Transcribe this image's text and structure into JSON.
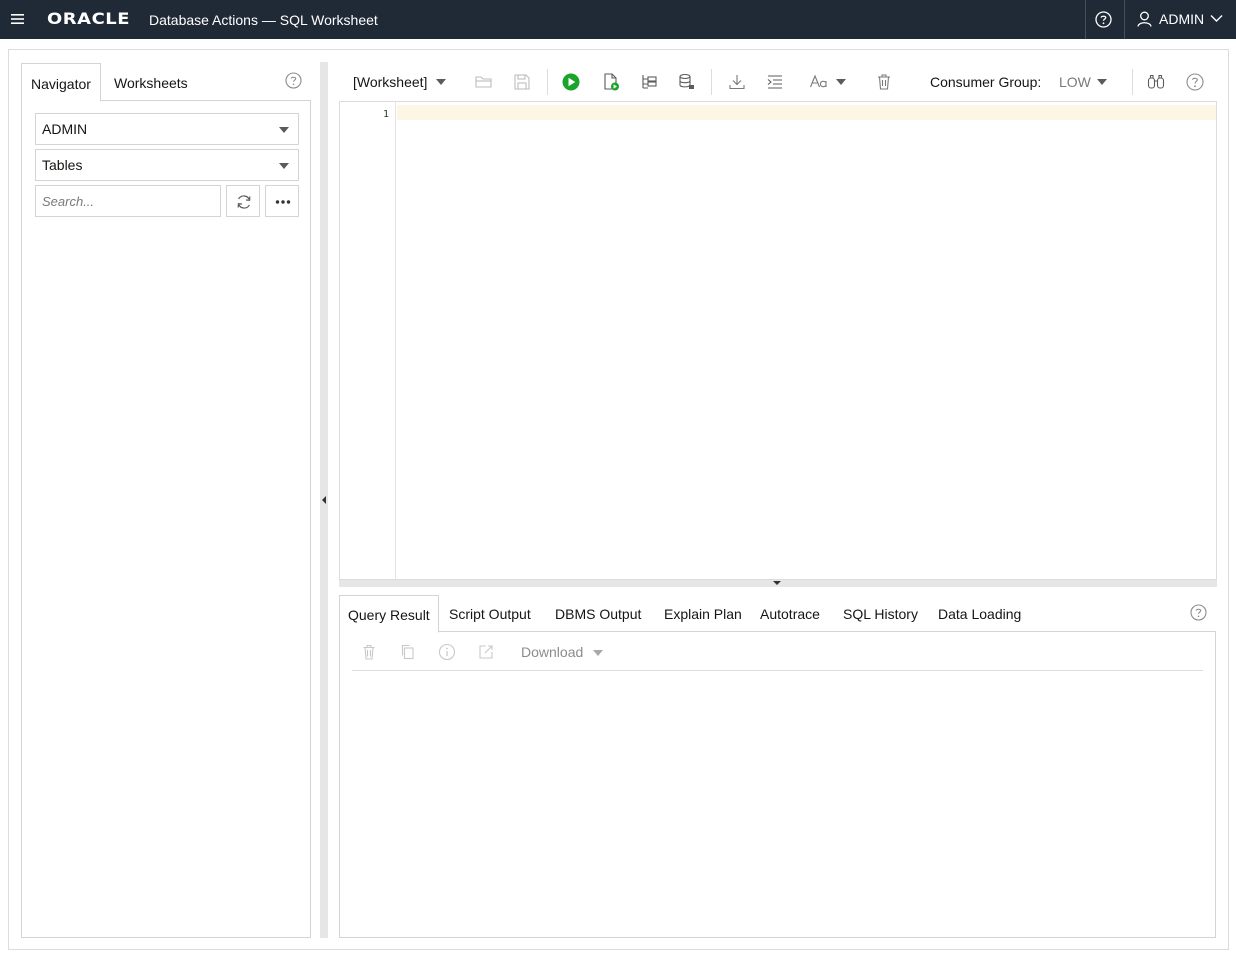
{
  "header": {
    "logo_text": "ORACLE",
    "app_title": "Database Actions — SQL Worksheet",
    "user_name": "ADMIN",
    "background": "#1f2a36"
  },
  "navigator": {
    "tabs": [
      {
        "label": "Navigator",
        "active": true
      },
      {
        "label": "Worksheets",
        "active": false
      }
    ],
    "schema_select": "ADMIN",
    "object_type_select": "Tables",
    "search_placeholder": "Search..."
  },
  "toolbar": {
    "worksheet_label": "[Worksheet]",
    "consumer_group_label": "Consumer Group:",
    "consumer_group_value": "LOW",
    "run_color": "#1aa52a",
    "icons": [
      "open-folder-icon",
      "save-icon",
      "run-statement-icon",
      "run-script-icon",
      "explain-plan-icon",
      "autotrace-icon",
      "download-icon",
      "format-icon",
      "font-case-icon",
      "clear-icon",
      "find-icon",
      "help-icon"
    ]
  },
  "editor": {
    "line_numbers": [
      "1"
    ],
    "active_line_color": "#fdf6e4"
  },
  "results": {
    "tabs": [
      {
        "label": "Query Result",
        "active": true
      },
      {
        "label": "Script Output",
        "active": false
      },
      {
        "label": "DBMS Output",
        "active": false
      },
      {
        "label": "Explain Plan",
        "active": false
      },
      {
        "label": "Autotrace",
        "active": false
      },
      {
        "label": "SQL History",
        "active": false
      },
      {
        "label": "Data Loading",
        "active": false
      }
    ],
    "download_label": "Download"
  }
}
